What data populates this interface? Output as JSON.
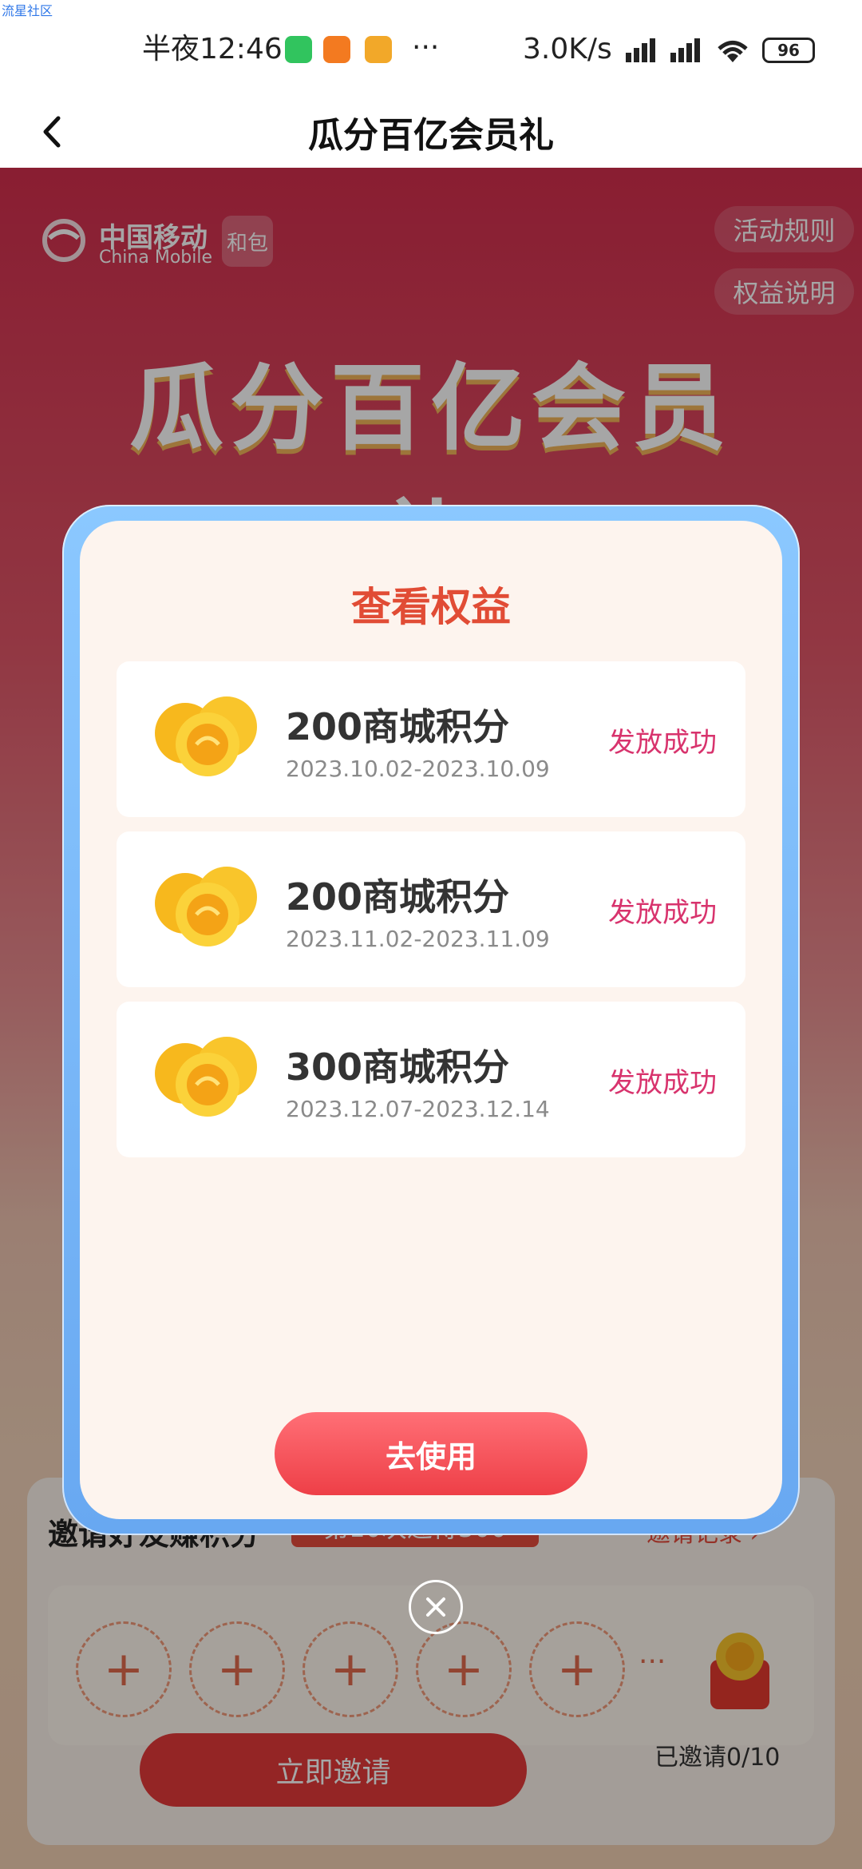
{
  "status_bar": {
    "corner_text": "流星社区",
    "time": "半夜12:46",
    "more": "···",
    "speed": "3.0K/s",
    "battery": "96"
  },
  "header": {
    "title": "瓜分百亿会员礼"
  },
  "background": {
    "brand_cn": "中国移动",
    "brand_en": "China Mobile",
    "hebao": "和包",
    "rules": "活动规则",
    "benefits_desc": "权益说明",
    "big_title": "瓜分百亿会员礼"
  },
  "modal": {
    "title": "查看权益",
    "items": [
      {
        "name": "200商城积分",
        "date": "2023.10.02-2023.10.09",
        "status": "发放成功"
      },
      {
        "name": "200商城积分",
        "date": "2023.11.02-2023.11.09",
        "status": "发放成功"
      },
      {
        "name": "300商城积分",
        "date": "2023.12.07-2023.12.14",
        "status": "发放成功"
      }
    ],
    "use_button": "去使用"
  },
  "invite": {
    "title": "邀请好友赚积分",
    "badge": "第10次邀得300",
    "record": "邀请记录 ›",
    "slot_plus": "+",
    "more": "···",
    "button": "立即邀请",
    "count": "已邀请0/10"
  }
}
